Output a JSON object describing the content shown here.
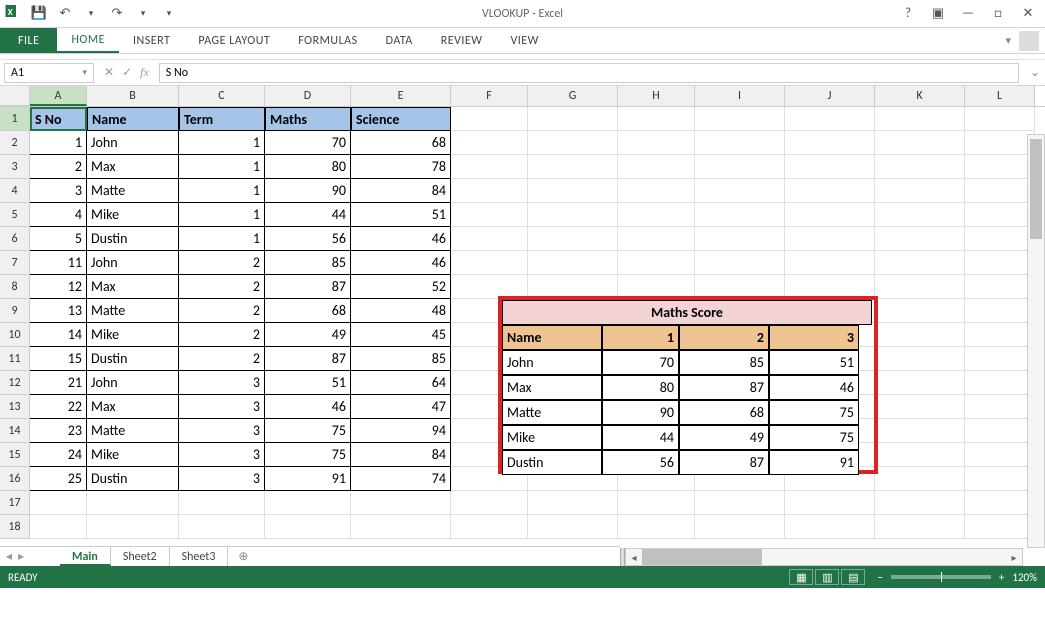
{
  "title": "VLOOKUP - Excel",
  "ribbon": {
    "file": "FILE",
    "tabs": [
      "HOME",
      "INSERT",
      "PAGE LAYOUT",
      "FORMULAS",
      "DATA",
      "REVIEW",
      "VIEW"
    ]
  },
  "namebox": "A1",
  "formula": "S No",
  "colheads": [
    "A",
    "B",
    "C",
    "D",
    "E",
    "F",
    "G",
    "H",
    "I",
    "J",
    "K",
    "L"
  ],
  "headers": {
    "A": "S No",
    "B": "Name",
    "C": "Term",
    "D": "Maths",
    "E": "Science"
  },
  "rows": [
    {
      "a": "1",
      "b": "John",
      "c": "1",
      "d": "70",
      "e": "68"
    },
    {
      "a": "2",
      "b": "Max",
      "c": "1",
      "d": "80",
      "e": "78"
    },
    {
      "a": "3",
      "b": "Matte",
      "c": "1",
      "d": "90",
      "e": "84"
    },
    {
      "a": "4",
      "b": "Mike",
      "c": "1",
      "d": "44",
      "e": "51"
    },
    {
      "a": "5",
      "b": "Dustin",
      "c": "1",
      "d": "56",
      "e": "46"
    },
    {
      "a": "11",
      "b": "John",
      "c": "2",
      "d": "85",
      "e": "46"
    },
    {
      "a": "12",
      "b": "Max",
      "c": "2",
      "d": "87",
      "e": "52"
    },
    {
      "a": "13",
      "b": "Matte",
      "c": "2",
      "d": "68",
      "e": "48"
    },
    {
      "a": "14",
      "b": "Mike",
      "c": "2",
      "d": "49",
      "e": "45"
    },
    {
      "a": "15",
      "b": "Dustin",
      "c": "2",
      "d": "87",
      "e": "85"
    },
    {
      "a": "21",
      "b": "John",
      "c": "3",
      "d": "51",
      "e": "64"
    },
    {
      "a": "22",
      "b": "Max",
      "c": "3",
      "d": "46",
      "e": "47"
    },
    {
      "a": "23",
      "b": "Matte",
      "c": "3",
      "d": "75",
      "e": "94"
    },
    {
      "a": "24",
      "b": "Mike",
      "c": "3",
      "d": "75",
      "e": "84"
    },
    {
      "a": "25",
      "b": "Dustin",
      "c": "3",
      "d": "91",
      "e": "74"
    }
  ],
  "overlay": {
    "title": "Maths Score",
    "cols": [
      "Name",
      "1",
      "2",
      "3"
    ],
    "rows": [
      [
        "John",
        "70",
        "85",
        "51"
      ],
      [
        "Max",
        "80",
        "87",
        "46"
      ],
      [
        "Matte",
        "90",
        "68",
        "75"
      ],
      [
        "Mike",
        "44",
        "49",
        "75"
      ],
      [
        "Dustin",
        "56",
        "87",
        "91"
      ]
    ]
  },
  "sheets": {
    "active": "Main",
    "others": [
      "Sheet2",
      "Sheet3"
    ]
  },
  "status": {
    "ready": "READY",
    "zoom": "120%"
  }
}
